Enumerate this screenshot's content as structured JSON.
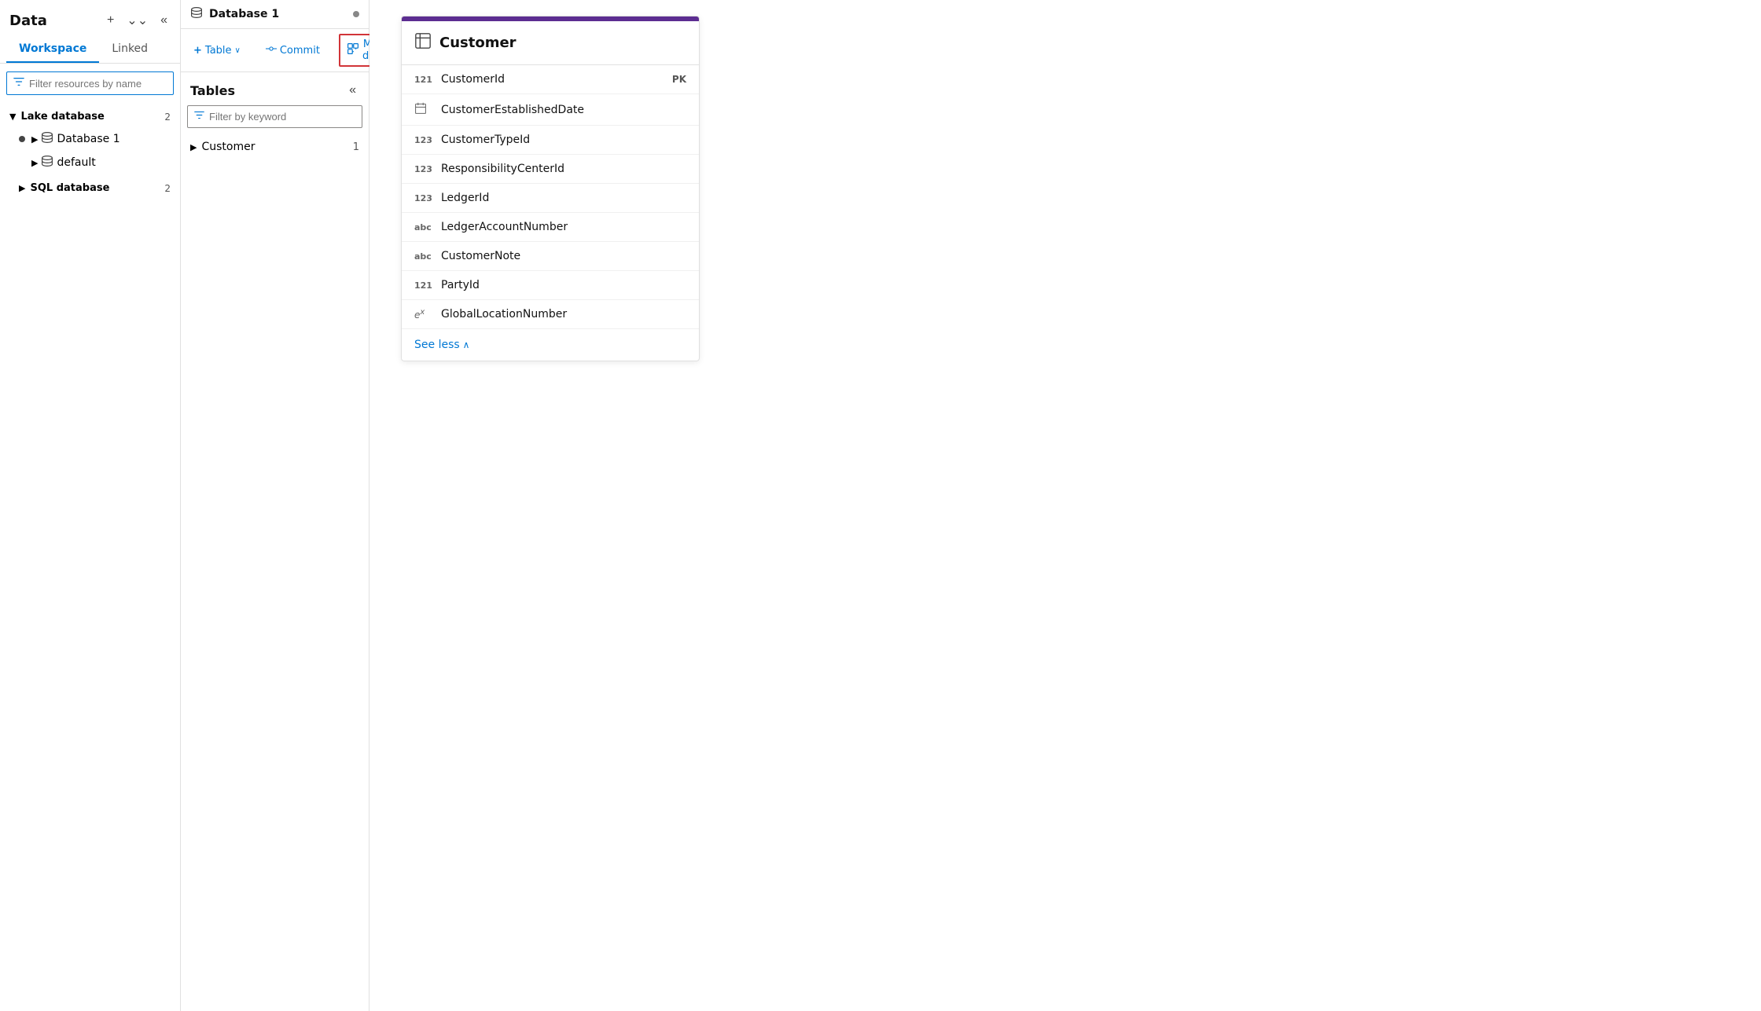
{
  "sidebar": {
    "title": "Data",
    "tabs": [
      {
        "label": "Workspace",
        "active": true
      },
      {
        "label": "Linked",
        "active": false
      }
    ],
    "filter_placeholder": "Filter resources by name",
    "sections": [
      {
        "label": "Lake database",
        "count": 2,
        "expanded": true,
        "items": [
          {
            "label": "Database 1",
            "has_dot": true,
            "has_expand": true
          },
          {
            "label": "default",
            "has_dot": false,
            "has_expand": true
          }
        ]
      },
      {
        "label": "SQL database",
        "count": 2,
        "expanded": false
      }
    ]
  },
  "middle": {
    "db_title": "Database 1",
    "toolbar": [
      {
        "label": "Table",
        "has_plus": true,
        "has_dropdown": true,
        "active": false
      },
      {
        "label": "Commit",
        "has_icon": true,
        "active": false
      },
      {
        "label": "Map data",
        "has_icon": true,
        "active": true
      }
    ],
    "tables_title": "Tables",
    "filter_kw_placeholder": "Filter by keyword",
    "table_rows": [
      {
        "label": "Customer",
        "count": 1
      }
    ]
  },
  "entity_card": {
    "title": "Customer",
    "fields": [
      {
        "type": "121",
        "name": "CustomerId",
        "pk": "PK"
      },
      {
        "type": "cal",
        "name": "CustomerEstablishedDate",
        "pk": ""
      },
      {
        "type": "123",
        "name": "CustomerTypeId",
        "pk": ""
      },
      {
        "type": "123",
        "name": "ResponsibilityCenterId",
        "pk": ""
      },
      {
        "type": "123",
        "name": "LedgerId",
        "pk": ""
      },
      {
        "type": "abc",
        "name": "LedgerAccountNumber",
        "pk": ""
      },
      {
        "type": "abc",
        "name": "CustomerNote",
        "pk": ""
      },
      {
        "type": "121",
        "name": "PartyId",
        "pk": ""
      },
      {
        "type": "ex",
        "name": "GlobalLocationNumber",
        "pk": ""
      }
    ],
    "see_less_label": "See less"
  },
  "icons": {
    "plus": "+",
    "chevron_down": "∨",
    "double_chevron_left": "«",
    "double_chevron_right": "»",
    "filter": "⊻",
    "database": "🗄",
    "table": "⊞",
    "commit": "⊶",
    "map_data": "⊟",
    "collapse": "«",
    "up_chevron": "∧"
  }
}
